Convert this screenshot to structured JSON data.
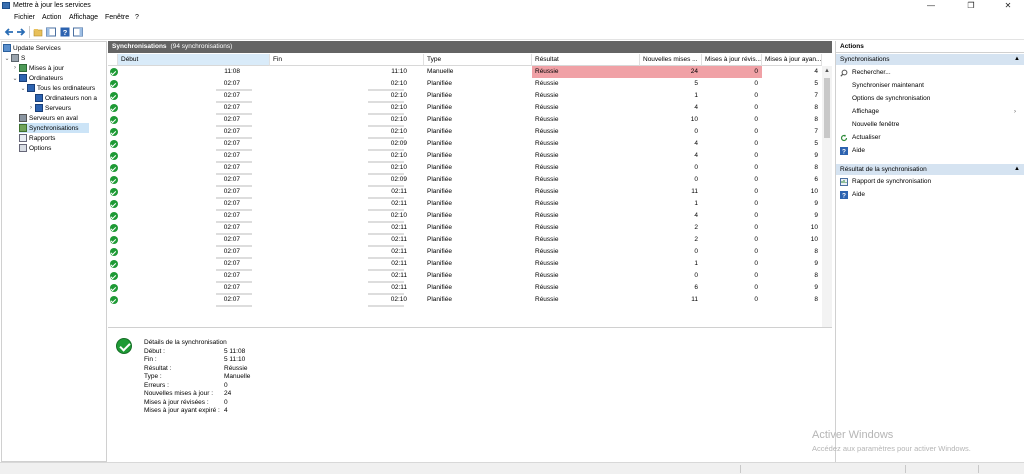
{
  "window": {
    "title": "Mettre à jour les services",
    "controls": [
      "—",
      "❐",
      "✕"
    ]
  },
  "menu": [
    "Fichier",
    "Action",
    "Affichage",
    "Fenêtre",
    "?"
  ],
  "tree": {
    "root": "Update Services",
    "server": "S",
    "items": [
      {
        "label": "Mises à jour"
      },
      {
        "label": "Ordinateurs"
      },
      {
        "label": "Tous les ordinateurs"
      },
      {
        "label": "Ordinateurs non a"
      },
      {
        "label": "Serveurs"
      },
      {
        "label": "Serveurs en aval"
      },
      {
        "label": "Synchronisations"
      },
      {
        "label": "Rapports"
      },
      {
        "label": "Options"
      }
    ]
  },
  "list": {
    "header_title": "Synchronisations",
    "header_count": "(94 synchronisations)",
    "columns": [
      "Début",
      "Fin",
      "Type",
      "Résultat",
      "Nouvelles mises ...",
      "Mises à jour révis...",
      "Mises à jour ayan..."
    ],
    "rows": [
      {
        "start": "11:08",
        "end": "11:10",
        "type": "Manuelle",
        "result": "Réussie",
        "new": "24",
        "rev": "0",
        "exp": "4",
        "highlight": true
      },
      {
        "start": "02:07",
        "end": "02:10",
        "type": "Planifiée",
        "result": "Réussie",
        "new": "5",
        "rev": "0",
        "exp": "5"
      },
      {
        "start": "02:07",
        "end": "02:10",
        "type": "Planifiée",
        "result": "Réussie",
        "new": "1",
        "rev": "0",
        "exp": "7"
      },
      {
        "start": "02:07",
        "end": "02:10",
        "type": "Planifiée",
        "result": "Réussie",
        "new": "4",
        "rev": "0",
        "exp": "8"
      },
      {
        "start": "02:07",
        "end": "02:10",
        "type": "Planifiée",
        "result": "Réussie",
        "new": "10",
        "rev": "0",
        "exp": "8"
      },
      {
        "start": "02:07",
        "end": "02:10",
        "type": "Planifiée",
        "result": "Réussie",
        "new": "0",
        "rev": "0",
        "exp": "7"
      },
      {
        "start": "02:07",
        "end": "02:09",
        "type": "Planifiée",
        "result": "Réussie",
        "new": "4",
        "rev": "0",
        "exp": "5"
      },
      {
        "start": "02:07",
        "end": "02:10",
        "type": "Planifiée",
        "result": "Réussie",
        "new": "4",
        "rev": "0",
        "exp": "9"
      },
      {
        "start": "02:07",
        "end": "02:10",
        "type": "Planifiée",
        "result": "Réussie",
        "new": "0",
        "rev": "0",
        "exp": "8"
      },
      {
        "start": "02:07",
        "end": "02:09",
        "type": "Planifiée",
        "result": "Réussie",
        "new": "0",
        "rev": "0",
        "exp": "6"
      },
      {
        "start": "02:07",
        "end": "02:11",
        "type": "Planifiée",
        "result": "Réussie",
        "new": "11",
        "rev": "0",
        "exp": "10"
      },
      {
        "start": "02:07",
        "end": "02:11",
        "type": "Planifiée",
        "result": "Réussie",
        "new": "1",
        "rev": "0",
        "exp": "9"
      },
      {
        "start": "02:07",
        "end": "02:10",
        "type": "Planifiée",
        "result": "Réussie",
        "new": "4",
        "rev": "0",
        "exp": "9"
      },
      {
        "start": "02:07",
        "end": "02:11",
        "type": "Planifiée",
        "result": "Réussie",
        "new": "2",
        "rev": "0",
        "exp": "10"
      },
      {
        "start": "02:07",
        "end": "02:11",
        "type": "Planifiée",
        "result": "Réussie",
        "new": "2",
        "rev": "0",
        "exp": "10"
      },
      {
        "start": "02:07",
        "end": "02:11",
        "type": "Planifiée",
        "result": "Réussie",
        "new": "0",
        "rev": "0",
        "exp": "8"
      },
      {
        "start": "02:07",
        "end": "02:11",
        "type": "Planifiée",
        "result": "Réussie",
        "new": "1",
        "rev": "0",
        "exp": "9"
      },
      {
        "start": "02:07",
        "end": "02:11",
        "type": "Planifiée",
        "result": "Réussie",
        "new": "0",
        "rev": "0",
        "exp": "8"
      },
      {
        "start": "02:07",
        "end": "02:11",
        "type": "Planifiée",
        "result": "Réussie",
        "new": "6",
        "rev": "0",
        "exp": "9"
      },
      {
        "start": "02:07",
        "end": "02:10",
        "type": "Planifiée",
        "result": "Réussie",
        "new": "11",
        "rev": "0",
        "exp": "8"
      }
    ]
  },
  "details": {
    "title": "Détails de la synchronisation",
    "fields": [
      {
        "label": "Début :",
        "value": "5 11:08"
      },
      {
        "label": "Fin :",
        "value": "5 11:10"
      },
      {
        "label": "Résultat :",
        "value": "Réussie"
      },
      {
        "label": "Type :",
        "value": "Manuelle"
      },
      {
        "label": "Erreurs :",
        "value": "0"
      },
      {
        "label": "Nouvelles mises à jour :",
        "value": "24"
      },
      {
        "label": "Mises à jour révisées :",
        "value": "0"
      },
      {
        "label": "Mises à jour ayant expiré :",
        "value": "4"
      }
    ]
  },
  "actions": {
    "title": "Actions",
    "section1": "Synchronisations",
    "items1": [
      {
        "label": "Rechercher...",
        "icon": "search-icon"
      },
      {
        "label": "Synchroniser maintenant",
        "icon": ""
      },
      {
        "label": "Options de synchronisation",
        "icon": ""
      },
      {
        "label": "Affichage",
        "icon": "",
        "submenu": true
      },
      {
        "label": "Nouvelle fenêtre",
        "icon": ""
      },
      {
        "label": "Actualiser",
        "icon": "refresh-icon"
      },
      {
        "label": "Aide",
        "icon": "help-icon"
      }
    ],
    "section2": "Résultat de la synchronisation",
    "items2": [
      {
        "label": "Rapport de synchronisation",
        "icon": "report-icon"
      },
      {
        "label": "Aide",
        "icon": "help-icon"
      }
    ]
  },
  "watermark": {
    "line1": "Activer Windows",
    "line2": "Accédez aux paramètres pour activer Windows."
  },
  "colors": {
    "highlight": "#f0a1a6",
    "header": "#646464",
    "section": "#d5e3f1",
    "success": "#1e9a35",
    "selected": "#cce4f7"
  }
}
